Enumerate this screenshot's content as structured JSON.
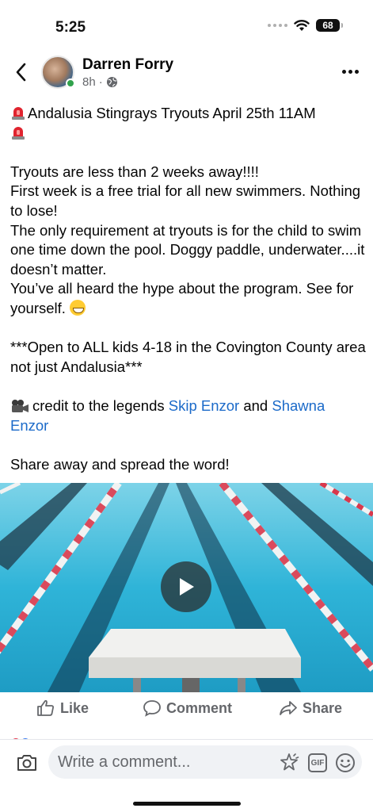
{
  "status_bar": {
    "time": "5:25",
    "battery": "68"
  },
  "post": {
    "author": "Darren Forry",
    "time_ago": "8h",
    "meta_separator": "·",
    "title": "Andalusia Stingrays Tryouts April 25th 11AM",
    "lines": [
      "Tryouts are less than 2 weeks away!!!!",
      "First week is a free trial for all new swimmers. Nothing to lose!",
      "The only requirement at tryouts is for the child to swim one time down the pool. Doggy paddle, underwater....it doesn’t matter.",
      "You’ve all heard the hype about the program. See for yourself."
    ],
    "open_to": "***Open to ALL kids 4-18 in the Covington County area not just Andalusia***",
    "credit_prefix": "credit to the legends",
    "credit_link1": "Skip Enzor",
    "credit_and": "and",
    "credit_link2": "Shawna Enzor",
    "share_line": "Share away and spread the word!"
  },
  "actions": {
    "like": "Like",
    "comment": "Comment",
    "share": "Share"
  },
  "comment_bar": {
    "placeholder": "Write a comment...",
    "gif": "GIF"
  },
  "icons": {
    "back": "chevron-left-icon",
    "more": "more-horizontal-icon",
    "globe": "globe-icon",
    "play": "play-icon",
    "like": "thumbs-up-icon",
    "comment": "speech-bubble-icon",
    "share": "share-arrow-icon",
    "camera": "camera-icon",
    "sticker": "sticker-icon",
    "emoji": "smiley-icon"
  },
  "colors": {
    "link": "#1b6ac9",
    "secondary_text": "#65676b",
    "online": "#31a24c"
  }
}
